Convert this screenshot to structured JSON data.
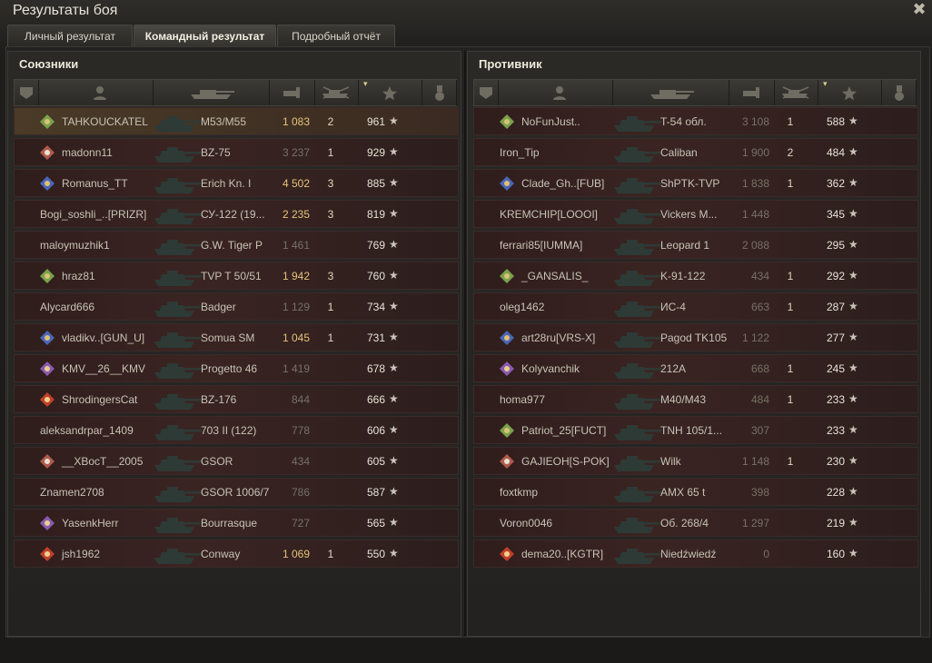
{
  "window": {
    "title": "Результаты боя",
    "close_icon": "✖"
  },
  "tabs": [
    {
      "label": "Личный результат",
      "active": false
    },
    {
      "label": "Командный результат",
      "active": true
    },
    {
      "label": "Подробный отчёт",
      "active": false
    }
  ],
  "colors": {
    "damage_highlight": "#e4c27a",
    "damage_normal": "#777166",
    "row_bg": "#3a2422",
    "self_row_bg": "#4a3a27"
  },
  "allies": {
    "title": "Союзники",
    "rows": [
      {
        "name": "TAHKOUCKATEL",
        "badge": true,
        "tank": "M53/M55",
        "damage": "1 083",
        "frags": "2",
        "xp": "961",
        "hi": true,
        "me": true
      },
      {
        "name": "madonn11",
        "badge": true,
        "tank": "BZ-75",
        "damage": "3 237",
        "frags": "1",
        "xp": "929",
        "hi": false
      },
      {
        "name": "Romanus_TT",
        "badge": true,
        "tank": "Erich Kn. I",
        "damage": "4 502",
        "frags": "3",
        "xp": "885",
        "hi": true
      },
      {
        "name": "Bogi_soshli_..[PRIZR]",
        "badge": false,
        "tank": "СУ-122 (19...",
        "damage": "2 235",
        "frags": "3",
        "xp": "819",
        "hi": true
      },
      {
        "name": "maloymuzhik1",
        "badge": false,
        "tank": "G.W. Tiger P",
        "damage": "1 461",
        "frags": "",
        "xp": "769",
        "hi": false
      },
      {
        "name": "hraz81",
        "badge": true,
        "tank": "TVP T 50/51",
        "damage": "1 942",
        "frags": "3",
        "xp": "760",
        "hi": true
      },
      {
        "name": "Alycard666",
        "badge": false,
        "tank": "Badger",
        "damage": "1 129",
        "frags": "1",
        "xp": "734",
        "hi": false
      },
      {
        "name": "vladikv..[GUN_U]",
        "badge": true,
        "tank": "Somua SM",
        "damage": "1 045",
        "frags": "1",
        "xp": "731",
        "hi": true
      },
      {
        "name": "KMV__26__KMV",
        "badge": true,
        "tank": "Progetto 46",
        "damage": "1 419",
        "frags": "",
        "xp": "678",
        "hi": false
      },
      {
        "name": "ShrodingersCat",
        "badge": true,
        "tank": "BZ-176",
        "damage": "844",
        "frags": "",
        "xp": "666",
        "hi": false
      },
      {
        "name": "aleksandrpar_1409",
        "badge": false,
        "tank": "703 II (122)",
        "damage": "778",
        "frags": "",
        "xp": "606",
        "hi": false
      },
      {
        "name": "__XBocT__2005",
        "badge": true,
        "tank": "GSOR",
        "damage": "434",
        "frags": "",
        "xp": "605",
        "hi": false
      },
      {
        "name": "Znamen2708",
        "badge": false,
        "tank": "GSOR 1006/7",
        "damage": "786",
        "frags": "",
        "xp": "587",
        "hi": false
      },
      {
        "name": "YasenkHerr",
        "badge": true,
        "tank": "Bourrasque",
        "damage": "727",
        "frags": "",
        "xp": "565",
        "hi": false
      },
      {
        "name": "jsh1962",
        "badge": true,
        "tank": "Conway",
        "damage": "1 069",
        "frags": "1",
        "xp": "550",
        "hi": true
      }
    ]
  },
  "enemies": {
    "title": "Противник",
    "rows": [
      {
        "name": "NoFunJust..",
        "badge": true,
        "tank": "T-54 обл.",
        "damage": "3 108",
        "frags": "1",
        "xp": "588",
        "hi": false
      },
      {
        "name": "Iron_Tip",
        "badge": false,
        "tank": "Caliban",
        "damage": "1 900",
        "frags": "2",
        "xp": "484",
        "hi": false
      },
      {
        "name": "Clade_Gh..[FUB]",
        "badge": true,
        "tank": "ShPTK-TVP",
        "damage": "1 838",
        "frags": "1",
        "xp": "362",
        "hi": false
      },
      {
        "name": "KREMCHIP[LOOOI]",
        "badge": false,
        "tank": "Vickers M...",
        "damage": "1 448",
        "frags": "",
        "xp": "345",
        "hi": false
      },
      {
        "name": "ferrari85[IUMMA]",
        "badge": false,
        "tank": "Leopard 1",
        "damage": "2 088",
        "frags": "",
        "xp": "295",
        "hi": false
      },
      {
        "name": "_GANSALIS_",
        "badge": true,
        "tank": "K-91-122",
        "damage": "434",
        "frags": "1",
        "xp": "292",
        "hi": false
      },
      {
        "name": "oleg1462",
        "badge": false,
        "tank": "ИС-4",
        "damage": "663",
        "frags": "1",
        "xp": "287",
        "hi": false
      },
      {
        "name": "art28ru[VRS-X]",
        "badge": true,
        "tank": "Pagod TK105",
        "damage": "1 122",
        "frags": "",
        "xp": "277",
        "hi": false
      },
      {
        "name": "Kolyvanchik",
        "badge": true,
        "tank": "212A",
        "damage": "668",
        "frags": "1",
        "xp": "245",
        "hi": false
      },
      {
        "name": "homa977",
        "badge": false,
        "tank": "M40/M43",
        "damage": "484",
        "frags": "1",
        "xp": "233",
        "hi": false
      },
      {
        "name": "Patriot_25[FUCT]",
        "badge": true,
        "tank": "TNH 105/1...",
        "damage": "307",
        "frags": "",
        "xp": "233",
        "hi": false
      },
      {
        "name": "GAJIEOH[S-POK]",
        "badge": true,
        "tank": "Wilk",
        "damage": "1 148",
        "frags": "1",
        "xp": "230",
        "hi": false
      },
      {
        "name": "foxtkmp",
        "badge": false,
        "tank": "AMX 65 t",
        "damage": "398",
        "frags": "",
        "xp": "228",
        "hi": false
      },
      {
        "name": "Voron0046",
        "badge": false,
        "tank": "Об. 268/4",
        "damage": "1 297",
        "frags": "",
        "xp": "219",
        "hi": false
      },
      {
        "name": "dema20..[KGTR]",
        "badge": true,
        "tank": "Niedźwiedź",
        "damage": "0",
        "frags": "",
        "xp": "160",
        "hi": false
      }
    ]
  },
  "header_icons": [
    "platoon-icon",
    "player-icon",
    "tank-icon",
    "damage-icon",
    "frags-icon",
    "xp-icon",
    "medal-icon"
  ],
  "star_glyph": "★"
}
